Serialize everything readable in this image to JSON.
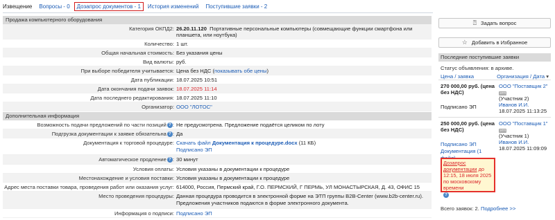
{
  "tabs": [
    {
      "label": "Извещение"
    },
    {
      "label": "Вопросы - 0"
    },
    {
      "label": "Дозапрос документов - 1"
    },
    {
      "label": "История изменений"
    },
    {
      "label": "Поступившие заявки - 2"
    }
  ],
  "sections": {
    "main_title": "Продажа компьютерного оборудования",
    "extra_title": "Дополнительная информация"
  },
  "fields": {
    "okpd_label": "Категория ОКПД2:",
    "okpd_code": "26.20.11.120",
    "okpd_text": "Портативные персональные компьютеры (совмещающие функции смартфона или планшета, или ноутбука)",
    "qty_label": "Количество:",
    "qty_value": "1 шт.",
    "total_label": "Общая начальная стоимость:",
    "total_value": "Без указания цены",
    "currency_label": "Вид валюты:",
    "currency_value": "руб.",
    "winner_label": "При выборе победителя учитывается:",
    "winner_value": "Цена без НДС",
    "winner_link": "показывать обе цены",
    "pub_label": "Дата публикации:",
    "pub_value": "18.07.2025 10:51",
    "end_label": "Дата окончания подачи заявок:",
    "end_value": "18.07.2025 11:14",
    "edit_label": "Дата последнего редактирования:",
    "edit_value": "18.07.2025 11:10",
    "org_label": "Организатор:",
    "org_value": "ООО \"ЛОТОС\""
  },
  "extra": {
    "partial_label": "Возможность подачи предложений по части позиций",
    "partial_value": "Не предусмотрена. Предложение подаётся целиком по лоту",
    "upload_label": "Подгрузка документации к заявке обязательна",
    "upload_value": "Да",
    "doc_label": "Документация к торговой процедуре:",
    "doc_download": "Скачать файл",
    "doc_file": "Документация к процедуре.docx",
    "doc_size": "(11 КБ)",
    "doc_signed": "Подписано ЭП",
    "auto_label": "Автоматическое продление",
    "auto_value": "30 минут",
    "pay_label": "Условия оплаты:",
    "pay_value": "Условия указаны в документации к процедуре",
    "place_label": "Местонахождение и условия поставки:",
    "place_value": "Условия указаны в документации к процедуре",
    "addr_label": "Адрес места поставки товара, проведения работ или оказания услуг:",
    "addr_value": "614000, Россия, Пермский край, Г.О. ПЕРМСКИЙ, Г ПЕРМЬ, УЛ МОНАСТЫРСКАЯ, Д. 43, ОФИС 15",
    "venue_label": "Место проведения процедуры:",
    "venue_line1": "Данная процедура проводится в электронной форме на ЭТП группы B2B-Center (www.b2b-center.ru).",
    "venue_line2": "Предложения участников подаются в форме электронного документа.",
    "sign_label": "Информация о подписи:",
    "sign_value": "Подписано ЭП"
  },
  "buttons": {
    "ask": "Задать вопрос",
    "fav": "Добавить в Избранное"
  },
  "panel": {
    "title": "Последние поступившие заявки",
    "status": "Статус объявления: в архиве.",
    "col_price": "Цена / заявка",
    "col_org": "Организация / Дата",
    "bid1_price": "270 000,00 руб. (цена без НДС)",
    "bid1_org": "ООО \"Поставщик 2\"",
    "bid1_badge": "ЭТП",
    "bid1_participant": "(Участник 2)",
    "bid1_signed": "Подписано ЭП",
    "bid1_person": "Иванов И.И.",
    "bid1_date": "18.07.2025 11:13:25",
    "bid2_price": "250 000,00 руб. (цена без НДС)",
    "bid2_org": "ООО \"Поставщик 1\"",
    "bid2_badge": "ЭТП",
    "bid2_participant": "(Участник 1)",
    "bid2_signed": "Подписано ЭП",
    "bid2_docs": "Документация (1 файл)",
    "bid2_person": "Иванов И.И.",
    "bid2_date": "18.07.2025 11:09:09",
    "notice_link": "Дозапрос документации",
    "notice_text": "до 12:15, 18 июля 2025 по московскому времени",
    "total": "Всего заявок: 2.",
    "more": "Подробнее >>"
  },
  "colors": {
    "link": "#1a5bb5",
    "alert": "#d9262b",
    "notice_bg": "#fff7d1",
    "section_bg": "#dadada"
  }
}
